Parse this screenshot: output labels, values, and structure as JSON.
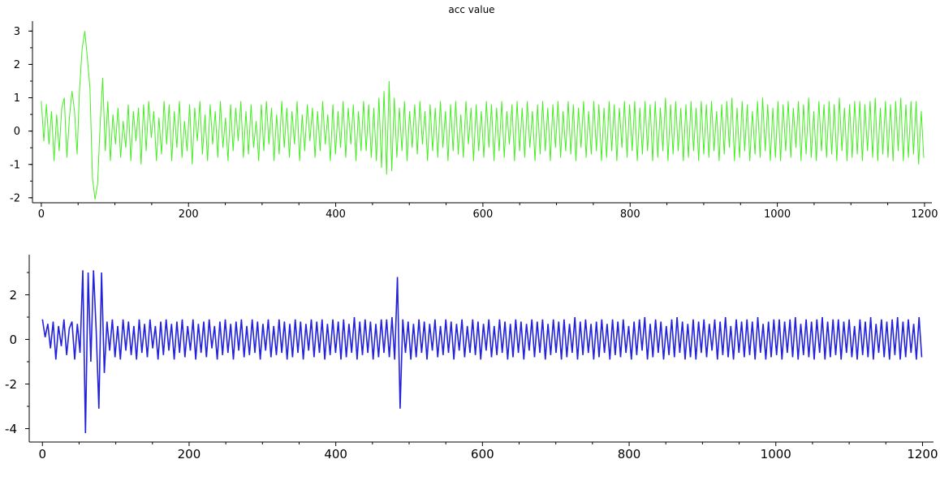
{
  "chart_data": [
    {
      "type": "line",
      "title": "acc value",
      "xlabel": "",
      "ylabel": "",
      "xlim": [
        -12,
        1210
      ],
      "ylim": [
        -2.15,
        3.3
      ],
      "xticks": [
        0,
        200,
        400,
        600,
        800,
        1000,
        1200
      ],
      "yticks": [
        -2,
        -1,
        0,
        1,
        2,
        3
      ],
      "grid": false,
      "color": "#44ee22",
      "x_range": [
        0,
        1199
      ],
      "series": [
        {
          "values": [
            0.9,
            -0.3,
            0.8,
            -0.4,
            0.6,
            -0.9,
            0.5,
            -0.6,
            0.7,
            1.0,
            -0.8,
            0.4,
            1.2,
            0.6,
            -0.7,
            1.3,
            2.5,
            3.0,
            2.2,
            1.3,
            -1.4,
            -2.05,
            -1.6,
            0.2,
            1.6,
            -0.6,
            0.9,
            -0.9,
            0.5,
            -0.4,
            0.7,
            -0.8,
            0.3,
            -0.5,
            0.8,
            -0.9,
            0.6,
            -0.3,
            0.7,
            -1.0,
            0.8,
            -0.6,
            0.9,
            -0.2,
            0.6,
            -0.9,
            0.4,
            -0.7,
            0.9,
            -0.4,
            0.8,
            -0.9,
            0.6,
            -0.5,
            0.9,
            -0.8,
            0.3,
            -0.6,
            0.8,
            -1.0,
            0.7,
            -0.3,
            0.9,
            -0.7,
            0.5,
            -0.9,
            0.8,
            -0.4,
            0.6,
            -0.8,
            0.9,
            -0.5,
            0.4,
            -0.9,
            0.8,
            -0.6,
            0.7,
            -0.3,
            0.9,
            -0.8,
            0.6,
            -0.7,
            0.8,
            -0.5,
            0.3,
            -0.9,
            0.8,
            -0.6,
            0.9,
            -0.4,
            0.7,
            -0.9,
            0.5,
            -0.7,
            0.9,
            -0.5,
            0.7,
            -0.8,
            0.6,
            -0.4,
            0.9,
            -0.9,
            0.5,
            -0.6,
            0.8,
            -0.3,
            0.7,
            -0.8,
            0.6,
            -0.6,
            0.9,
            -0.4,
            0.5,
            -0.9,
            0.8,
            -0.7,
            0.6,
            -0.5,
            0.9,
            -0.8,
            0.7,
            -0.4,
            0.8,
            -0.9,
            0.6,
            -0.6,
            0.9,
            -0.6,
            0.8,
            -0.8,
            0.7,
            -0.9,
            1.0,
            -1.1,
            1.2,
            -1.3,
            1.5,
            -1.2,
            1.0,
            -0.8,
            0.7,
            -0.6,
            0.9,
            -0.9,
            0.6,
            -0.5,
            0.8,
            -0.7,
            0.9,
            -0.4,
            0.6,
            -0.9,
            0.8,
            -0.6,
            0.7,
            -0.8,
            0.9,
            -0.5,
            0.6,
            -0.9,
            0.8,
            -0.6,
            0.9,
            -0.7,
            0.5,
            -0.8,
            0.9,
            -0.4,
            0.7,
            -0.9,
            0.8,
            -0.6,
            0.6,
            -0.8,
            0.9,
            -0.5,
            0.8,
            -0.9,
            0.7,
            -0.6,
            0.9,
            -0.8,
            0.6,
            -0.4,
            0.8,
            -0.9,
            0.9,
            -0.6,
            0.7,
            -0.8,
            0.9,
            -0.5,
            0.6,
            -0.9,
            0.8,
            -0.7,
            0.9,
            -0.6,
            0.7,
            -0.9,
            0.8,
            -0.5,
            0.9,
            -0.8,
            0.6,
            -0.6,
            0.9,
            -0.7,
            0.8,
            -0.9,
            0.7,
            -0.5,
            0.9,
            -0.8,
            0.6,
            -0.7,
            0.9,
            -0.6,
            0.8,
            -0.9,
            0.7,
            -0.8,
            0.9,
            -0.6,
            0.8,
            -0.9,
            0.7,
            -0.5,
            0.9,
            -0.8,
            0.8,
            -0.6,
            0.9,
            -0.9,
            0.7,
            -0.7,
            0.9,
            -0.6,
            0.8,
            -0.9,
            0.9,
            -0.8,
            0.7,
            -0.6,
            1.0,
            -0.9,
            0.8,
            -0.7,
            0.9,
            -0.6,
            0.7,
            -0.9,
            0.8,
            -0.8,
            0.9,
            -0.6,
            0.7,
            -0.9,
            0.9,
            -0.7,
            0.8,
            -0.8,
            0.9,
            -0.6,
            0.6,
            -0.9,
            0.8,
            -0.7,
            0.9,
            -0.5,
            1.0,
            -0.9,
            0.7,
            -0.8,
            0.9,
            -0.6,
            0.8,
            -0.9,
            0.6,
            -0.7,
            0.9,
            -0.8,
            1.0,
            -0.6,
            0.8,
            -0.9,
            0.7,
            -0.8,
            0.9,
            -0.9,
            0.8,
            -0.6,
            0.9,
            -0.8,
            0.7,
            -0.5,
            0.9,
            -0.9,
            0.8,
            -0.7,
            1.0,
            -0.8,
            0.6,
            -0.9,
            0.9,
            -0.6,
            0.8,
            -0.8,
            0.9,
            -0.7,
            0.8,
            -0.9,
            1.0,
            -0.6,
            0.7,
            -0.9,
            0.8,
            -0.8,
            0.9,
            -0.7,
            0.9,
            -0.9,
            0.8,
            -0.6,
            0.9,
            -0.8,
            1.0,
            -0.9,
            0.7,
            -0.7,
            0.9,
            -0.8,
            0.8,
            -0.9,
            0.9,
            -0.6,
            1.0,
            -0.9,
            0.8,
            -0.8,
            0.9,
            -0.7,
            0.9,
            -1.0,
            0.6,
            -0.8
          ]
        }
      ]
    },
    {
      "type": "line",
      "title": "",
      "xlabel": "",
      "ylabel": "",
      "xlim": [
        -18,
        1215
      ],
      "ylim": [
        -4.6,
        3.8
      ],
      "xticks": [
        0,
        200,
        400,
        600,
        800,
        1000,
        1200
      ],
      "yticks": [
        -4,
        -2,
        0,
        2
      ],
      "grid": false,
      "color": "#2222dd",
      "x_range": [
        0,
        1199
      ],
      "series": [
        {
          "values": [
            0.9,
            0.1,
            0.7,
            -0.4,
            0.8,
            -0.9,
            0.6,
            -0.3,
            0.9,
            -0.7,
            0.5,
            0.8,
            -0.9,
            0.7,
            -0.6,
            3.1,
            -4.2,
            3.0,
            -1.0,
            3.1,
            0.4,
            -3.1,
            3.0,
            -1.5,
            0.8,
            -0.5,
            0.9,
            -0.8,
            0.6,
            -0.9,
            0.9,
            -0.5,
            0.8,
            -0.7,
            0.6,
            -0.9,
            0.9,
            -0.6,
            0.7,
            -0.8,
            0.9,
            -0.4,
            0.6,
            -0.9,
            0.8,
            -0.7,
            0.9,
            -0.5,
            0.7,
            -0.9,
            0.8,
            -0.6,
            0.9,
            -0.8,
            0.6,
            -0.5,
            0.9,
            -0.9,
            0.7,
            -0.6,
            0.8,
            -0.8,
            0.9,
            -0.4,
            0.6,
            -0.9,
            0.8,
            -0.7,
            0.9,
            -0.6,
            0.7,
            -0.9,
            0.8,
            -0.5,
            0.9,
            -0.8,
            0.6,
            -0.7,
            0.9,
            -0.6,
            0.8,
            -0.9,
            0.7,
            -0.5,
            0.9,
            -0.8,
            0.6,
            -0.7,
            0.9,
            -0.6,
            0.8,
            -0.9,
            0.7,
            -0.8,
            0.9,
            -0.6,
            0.8,
            -0.9,
            0.7,
            -0.5,
            0.9,
            -0.8,
            0.8,
            -0.6,
            0.9,
            -0.9,
            0.7,
            -0.7,
            0.9,
            -0.6,
            0.8,
            -0.9,
            0.9,
            -0.8,
            0.7,
            -0.6,
            1.0,
            -0.9,
            0.8,
            -0.7,
            0.9,
            -0.6,
            0.8,
            -0.9,
            0.7,
            -0.8,
            0.9,
            -0.6,
            0.9,
            -0.8,
            1.0,
            -0.9,
            2.8,
            -3.1,
            0.9,
            -0.6,
            0.8,
            -0.9,
            0.7,
            -0.8,
            0.9,
            -0.6,
            0.8,
            -0.9,
            0.7,
            -0.5,
            0.9,
            -0.8,
            0.6,
            -0.7,
            0.9,
            -0.6,
            0.8,
            -0.9,
            0.7,
            -0.5,
            0.9,
            -0.8,
            0.6,
            -0.6,
            0.9,
            -0.7,
            0.8,
            -0.9,
            0.7,
            -0.5,
            0.9,
            -0.8,
            0.6,
            -0.7,
            0.9,
            -0.6,
            0.8,
            -0.9,
            0.7,
            -0.8,
            0.9,
            -0.6,
            0.8,
            -0.9,
            0.7,
            -0.5,
            0.9,
            -0.8,
            0.8,
            -0.6,
            0.9,
            -0.9,
            0.7,
            -0.7,
            0.9,
            -0.6,
            0.8,
            -0.9,
            0.9,
            -0.8,
            0.7,
            -0.6,
            1.0,
            -0.9,
            0.8,
            -0.7,
            0.9,
            -0.6,
            0.7,
            -0.9,
            0.8,
            -0.8,
            0.9,
            -0.6,
            0.7,
            -0.9,
            0.9,
            -0.7,
            0.8,
            -0.8,
            0.9,
            -0.6,
            0.6,
            -0.9,
            0.8,
            -0.7,
            0.9,
            -0.5,
            1.0,
            -0.9,
            0.7,
            -0.8,
            0.9,
            -0.6,
            0.8,
            -0.9,
            0.6,
            -0.7,
            0.9,
            -0.8,
            1.0,
            -0.6,
            0.8,
            -0.9,
            0.7,
            -0.8,
            0.9,
            -0.9,
            0.8,
            -0.6,
            0.9,
            -0.8,
            0.7,
            -0.5,
            0.9,
            -0.9,
            0.8,
            -0.7,
            1.0,
            -0.8,
            0.6,
            -0.9,
            0.9,
            -0.6,
            0.8,
            -0.8,
            0.9,
            -0.7,
            0.8,
            -0.9,
            1.0,
            -0.6,
            0.7,
            -0.9,
            0.8,
            -0.8,
            0.9,
            -0.7,
            0.9,
            -0.9,
            0.8,
            -0.6,
            0.9,
            -0.8,
            1.0,
            -0.9,
            0.7,
            -0.7,
            0.9,
            -0.8,
            0.8,
            -0.9,
            0.9,
            -0.6,
            1.0,
            -0.9,
            0.8,
            -0.8,
            0.9,
            -0.7,
            0.9,
            -0.9,
            0.8,
            -0.6,
            0.9,
            -0.8,
            0.6,
            -0.9,
            0.9,
            -0.7,
            0.8,
            -0.8,
            1.0,
            -0.9,
            0.7,
            -0.6,
            0.9,
            -0.8,
            0.8,
            -0.9,
            0.9,
            -0.7,
            1.0,
            -0.9,
            0.8,
            -0.8,
            0.9,
            -0.6,
            0.7,
            -0.9,
            1.0,
            -0.8
          ]
        }
      ]
    }
  ]
}
